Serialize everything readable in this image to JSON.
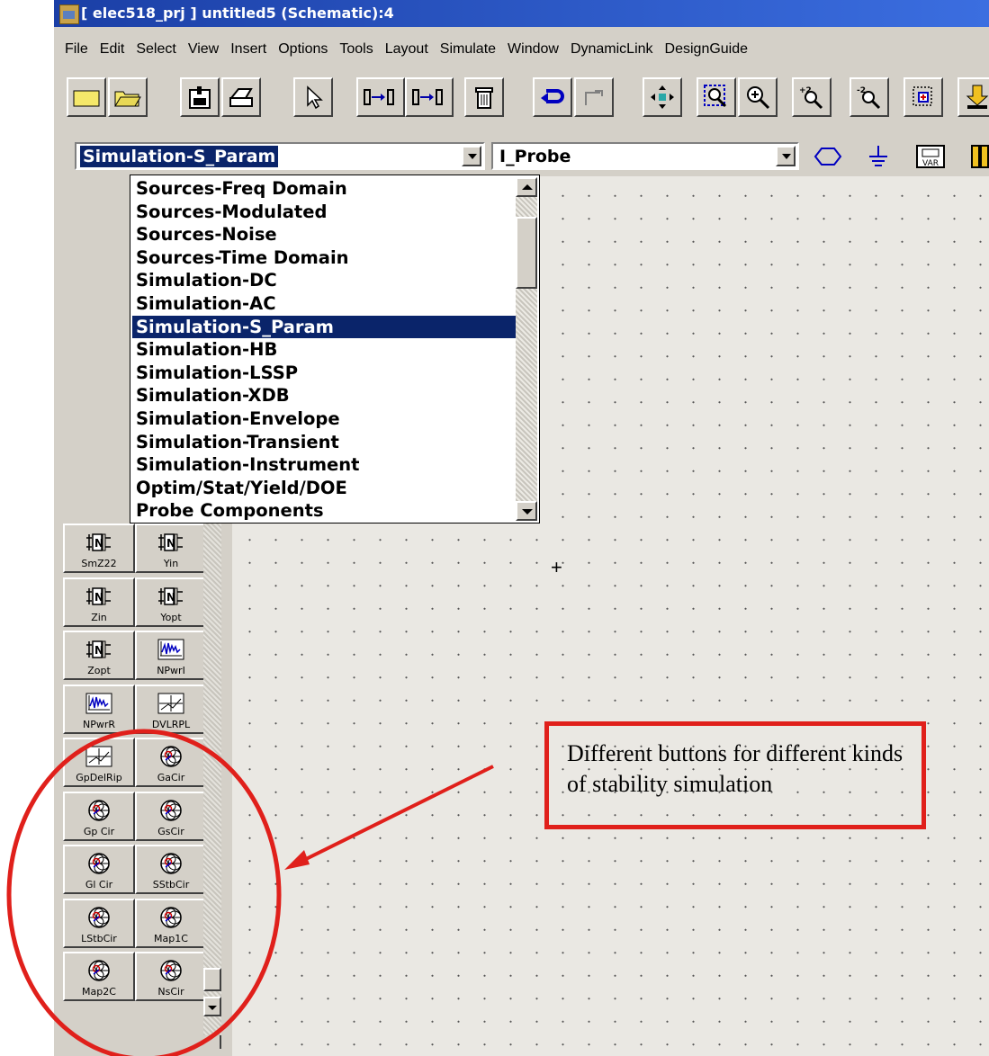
{
  "window": {
    "title": "[ elec518_prj ] untitled5 (Schematic):4"
  },
  "menu": [
    "File",
    "Edit",
    "Select",
    "View",
    "Insert",
    "Options",
    "Tools",
    "Layout",
    "Simulate",
    "Window",
    "DynamicLink",
    "DesignGuide"
  ],
  "toolbar": {
    "icons": [
      "new-icon",
      "open-icon",
      "save-icon",
      "print-icon",
      "select-pointer-icon",
      "push-icon",
      "pop-icon",
      "delete-icon",
      "undo-icon",
      "redo-icon",
      "move-icon",
      "zoom-area-icon",
      "zoom-in-icon",
      "zoom-in-2-icon",
      "zoom-out-2-icon",
      "view-all-icon",
      "download-icon"
    ],
    "zoom_in_2_text": "+2",
    "zoom_out_2_text": "-2"
  },
  "library_combo": {
    "value": "Simulation-S_Param"
  },
  "component_combo": {
    "value": "I_Probe"
  },
  "palette_buttons": {
    "var_label": "VAR"
  },
  "dropdown": {
    "items": [
      "Sources-Freq Domain",
      "Sources-Modulated",
      "Sources-Noise",
      "Sources-Time Domain",
      "Simulation-DC",
      "Simulation-AC",
      "Simulation-S_Param",
      "Simulation-HB",
      "Simulation-LSSP",
      "Simulation-XDB",
      "Simulation-Envelope",
      "Simulation-Transient",
      "Simulation-Instrument",
      "Optim/Stat/Yield/DOE",
      "Probe Components"
    ],
    "selected_index": 6
  },
  "component_palette": [
    {
      "label": "SmZ22",
      "icon": "n-port-icon"
    },
    {
      "label": "Yin",
      "icon": "n-port-icon"
    },
    {
      "label": "Zin",
      "icon": "n-port-icon"
    },
    {
      "label": "Yopt",
      "icon": "n-port-icon"
    },
    {
      "label": "Zopt",
      "icon": "n-port-icon"
    },
    {
      "label": "NPwrI",
      "icon": "noise-power-icon"
    },
    {
      "label": "NPwrR",
      "icon": "noise-power-icon"
    },
    {
      "label": "DVLRPL",
      "icon": "group-delay-icon"
    },
    {
      "label": "GpDelRip",
      "icon": "group-delay-icon"
    },
    {
      "label": "GaCir",
      "icon": "smith-circle-icon"
    },
    {
      "label": "Gp Cir",
      "icon": "smith-circle-icon"
    },
    {
      "label": "GsCir",
      "icon": "smith-circle-icon"
    },
    {
      "label": "Gl Cir",
      "icon": "smith-circle-icon"
    },
    {
      "label": "SStbCir",
      "icon": "smith-circle-icon"
    },
    {
      "label": "LStbCir",
      "icon": "smith-circle-icon"
    },
    {
      "label": "Map1C",
      "icon": "smith-circle-icon"
    },
    {
      "label": "Map2C",
      "icon": "smith-circle-icon"
    },
    {
      "label": "NsCir",
      "icon": "smith-circle-icon"
    }
  ],
  "annotation": {
    "text": "Different buttons for different kinds of stability simulation",
    "color": "#e0201b"
  },
  "colors": {
    "titlebar": "#1b3fa6",
    "selection": "#0a246a",
    "chrome": "#d4d0c8"
  }
}
